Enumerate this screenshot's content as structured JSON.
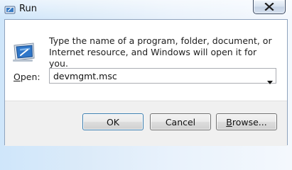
{
  "window": {
    "title": "Run"
  },
  "dialog": {
    "description": "Type the name of a program, folder, document, or Internet resource, and Windows will open it for you.",
    "open_label_mnemonic": "O",
    "open_label_rest": "pen:",
    "command_value": "devmgmt.msc"
  },
  "buttons": {
    "ok": "OK",
    "cancel": "Cancel",
    "browse_mnemonic": "B",
    "browse_rest": "rowse..."
  },
  "icons": {
    "title": "run-icon",
    "app": "run-program-icon",
    "close": "close-icon",
    "dropdown": "chevron-down-icon"
  },
  "colors": {
    "accent_blue": "#3c7fb1",
    "close_border": "#3a4a63"
  }
}
